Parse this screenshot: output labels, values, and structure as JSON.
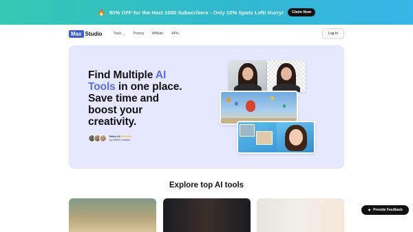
{
  "promo": {
    "fire_icon": "🔥",
    "text": "50% OFF for the Next 1000 Subscribers - Only 10% Spots Left! Hurry!",
    "claim_label": "Claim Now"
  },
  "nav": {
    "logo_box": "Max",
    "logo_text": "Studio",
    "items": [
      "Tools",
      "Pricing",
      "Affiliate",
      "APIs"
    ],
    "login_label": "Log In"
  },
  "hero": {
    "line1_prefix": "Find Multiple ",
    "line1_accent": "AI",
    "line2_accent": "Tools",
    "line2_rest": " in one place.",
    "line3": "Save time and",
    "line4": "boost your",
    "line5": "creativity.",
    "rating_label": "Rated 4.8",
    "stars": "★★★★★",
    "rating_sub": "by 10000+ creators"
  },
  "section": {
    "title": "Explore top AI tools"
  },
  "feedback": {
    "icon": "✦",
    "label": "Provide Feedback"
  },
  "colors": {
    "accent": "#5b6cf0",
    "brand": "#3a5bd9",
    "hero_bg": "#e5e8ff",
    "promo_start": "#35c9b3",
    "promo_end": "#38b6e8"
  }
}
